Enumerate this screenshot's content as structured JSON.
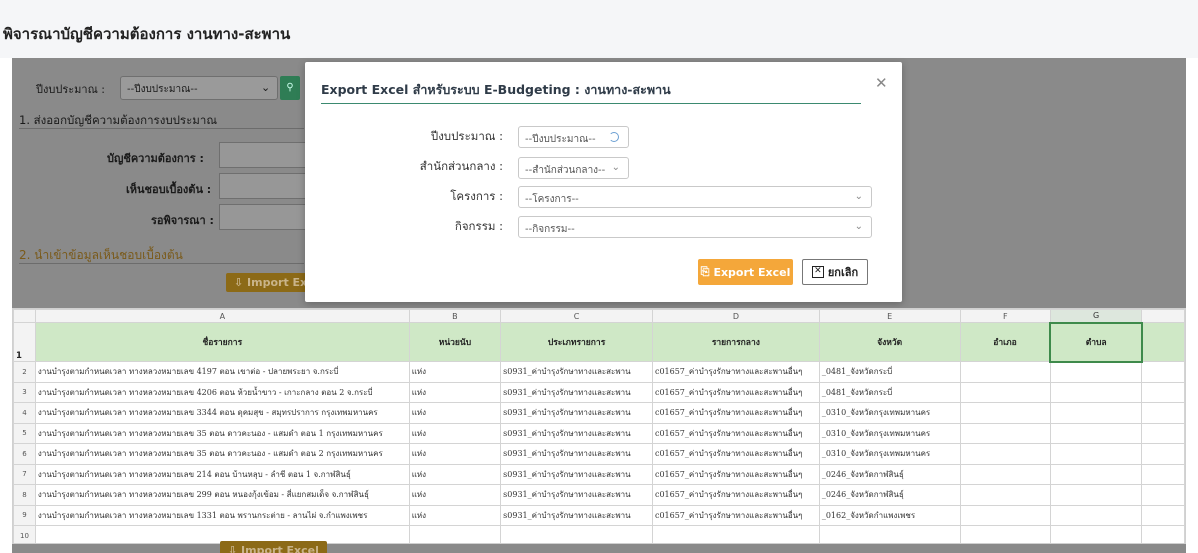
{
  "page": {
    "title": "พิจารณาบัญชีความต้องการ งานทาง-สะพาน"
  },
  "background": {
    "budget_year_label": "ปีงบประมาณ :",
    "budget_year_value": "--ปีงบประมาณ--",
    "section1_title": "1. ส่งออกบัญชีความต้องการงบประมาณ",
    "field_requirement": "บัญชีความต้องการ :",
    "field_agree": "เห็นชอบเบื้องต้น :",
    "field_pending": "รอพิจารณา :",
    "section2_title": "2. นำเข้าข้อมูลเห็นชอบเบื้องต้น",
    "import_label": "Import Excel"
  },
  "modal": {
    "title": "Export Excel สำหรับระบบ E-Budgeting : งานทาง-สะพาน",
    "close_icon": "close-icon",
    "fields": {
      "budget_year": {
        "label": "ปีงบประมาณ :",
        "value": "--ปีงบประมาณ--"
      },
      "central_office": {
        "label": "สำนักส่วนกลาง :",
        "value": "--สำนักส่วนกลาง--"
      },
      "project": {
        "label": "โครงการ :",
        "value": "--โครงการ--"
      },
      "activity": {
        "label": "กิจกรรม :",
        "value": "--กิจกรรม--"
      }
    },
    "export_button": "Export Excel",
    "cancel_button": "ยกเลิก"
  },
  "sheet": {
    "columns": [
      "A",
      "B",
      "C",
      "D",
      "E",
      "F",
      "G"
    ],
    "headers": [
      "ชื่อรายการ",
      "หน่วยนับ",
      "ประเภทรายการ",
      "รายการกลาง",
      "จังหวัด",
      "อำเภอ",
      "ตำบล"
    ],
    "rows": [
      [
        "งานบำรุงตามกำหนดเวลา ทางหลวงหมายเลข 4197 ตอน เขาต่อ - ปลายพระยา จ.กระบี่",
        "แห่ง",
        "s0931_ค่าบำรุงรักษาทางและสะพาน",
        "c01657_ค่าบำรุงรักษาทางและสะพานอื่นๆ",
        "_0481_จังหวัดกระบี่",
        "",
        ""
      ],
      [
        "งานบำรุงตามกำหนดเวลา ทางหลวงหมายเลข 4206 ตอน ห้วยน้ำขาว - เกาะกลาง ตอน 2 จ.กระบี่",
        "แห่ง",
        "s0931_ค่าบำรุงรักษาทางและสะพาน",
        "c01657_ค่าบำรุงรักษาทางและสะพานอื่นๆ",
        "_0481_จังหวัดกระบี่",
        "",
        ""
      ],
      [
        "งานบำรุงตามกำหนดเวลา ทางหลวงหมายเลข 3344 ตอน ดุคมสุข - สมุทรปราการ กรุงเทพมหานคร",
        "แห่ง",
        "s0931_ค่าบำรุงรักษาทางและสะพาน",
        "c01657_ค่าบำรุงรักษาทางและสะพานอื่นๆ",
        "_0310_จังหวัดกรุงเทพมหานคร",
        "",
        ""
      ],
      [
        "งานบำรุงตามกำหนดเวลา ทางหลวงหมายเลข 35 ตอน ดาวคะนอง - แสมดำ ตอน 1 กรุงเทพมหานคร",
        "แห่ง",
        "s0931_ค่าบำรุงรักษาทางและสะพาน",
        "c01657_ค่าบำรุงรักษาทางและสะพานอื่นๆ",
        "_0310_จังหวัดกรุงเทพมหานคร",
        "",
        ""
      ],
      [
        "งานบำรุงตามกำหนดเวลา ทางหลวงหมายเลข 35 ตอน ดาวคะนอง - แสมดำ ตอน 2 กรุงเทพมหานคร",
        "แห่ง",
        "s0931_ค่าบำรุงรักษาทางและสะพาน",
        "c01657_ค่าบำรุงรักษาทางและสะพานอื่นๆ",
        "_0310_จังหวัดกรุงเทพมหานคร",
        "",
        ""
      ],
      [
        "งานบำรุงตามกำหนดเวลา ทางหลวงหมายเลข 214 ตอน บ้านหลุบ - ลำชี ตอน 1 จ.กาฬสินธุ์",
        "แห่ง",
        "s0931_ค่าบำรุงรักษาทางและสะพาน",
        "c01657_ค่าบำรุงรักษาทางและสะพานอื่นๆ",
        "_0246_จังหวัดกาฬสินธุ์",
        "",
        ""
      ],
      [
        "งานบำรุงตามกำหนดเวลา ทางหลวงหมายเลข 299 ตอน หนองกุ้งเข้อม - สี่แยกสมเด็จ จ.กาฬสินธุ์",
        "แห่ง",
        "s0931_ค่าบำรุงรักษาทางและสะพาน",
        "c01657_ค่าบำรุงรักษาทางและสะพานอื่นๆ",
        "_0246_จังหวัดกาฬสินธุ์",
        "",
        ""
      ],
      [
        "งานบำรุงตามกำหนดเวลา ทางหลวงหมายเลข 1331 ตอน พรานกระต่าย - ลานไผ่ จ.กำแพงเพชร",
        "แห่ง",
        "s0931_ค่าบำรุงรักษาทางและสะพาน",
        "c01657_ค่าบำรุงรักษาทางและสะพานอื่นๆ",
        "_0162_จังหวัดกำแพงเพชร",
        "",
        ""
      ]
    ],
    "row_numbers": [
      "1",
      "2",
      "3",
      "4",
      "5",
      "6",
      "7",
      "8",
      "9",
      "10"
    ]
  }
}
